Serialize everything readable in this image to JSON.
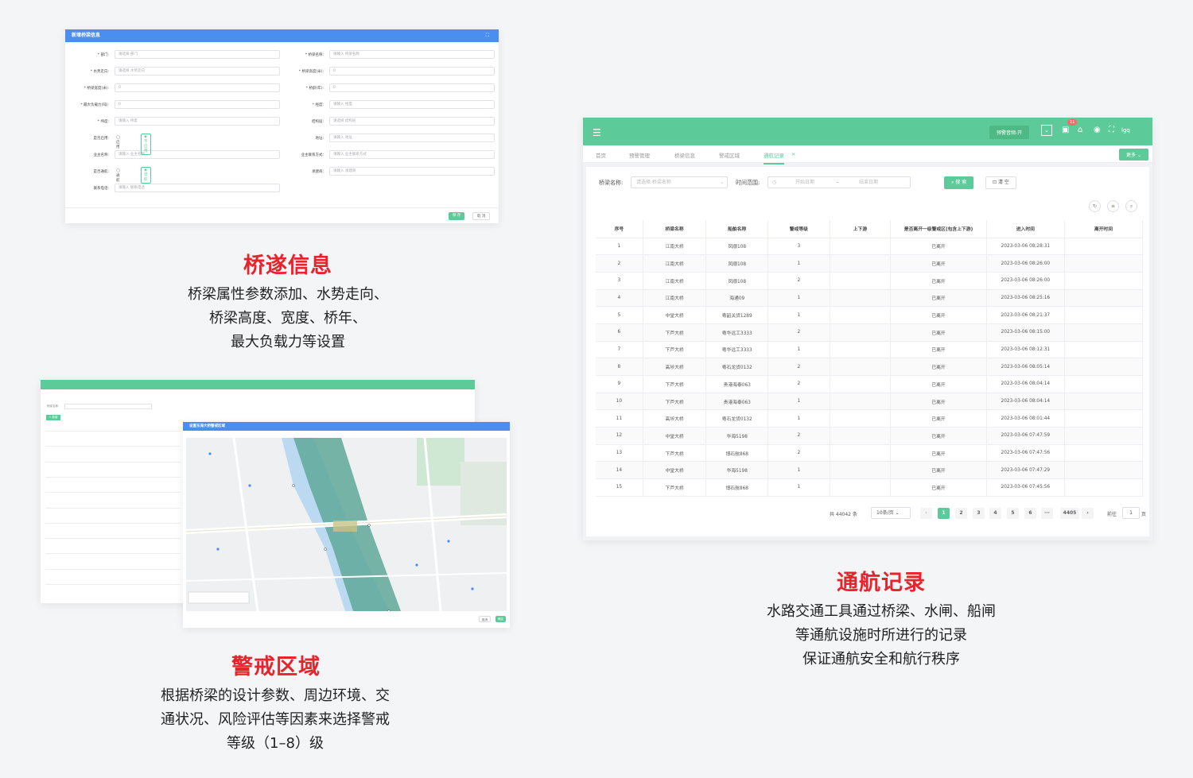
{
  "sections": {
    "bridge": {
      "title": "桥遂信息",
      "lines": [
        "桥梁属性参数添加、水势走向、",
        "桥梁高度、宽度、桥年、",
        "最大负载力等设置"
      ]
    },
    "alert": {
      "title": "警戒区域",
      "lines": [
        "根据桥梁的设计参数、周边环境、交",
        "通状况、风险评估等因素来选择警戒",
        "等级（1–8）级"
      ]
    },
    "navigation": {
      "title": "通航记录",
      "lines": [
        "水路交通工具通过桥梁、水闸、船闸",
        "等通航设施时所进行的记录",
        "保证通航安全和航行秩序"
      ]
    }
  },
  "form": {
    "header": "新增桥梁信息",
    "expand_icon": "expand-icon",
    "fields": [
      {
        "label": "* 部门:",
        "value": "请选择 部门"
      },
      {
        "label": "* 桥梁名称:",
        "value": "请输入 桥梁名称"
      },
      {
        "label": "* 水势走向:",
        "value": "请选择 水势走向"
      },
      {
        "label": "* 桥梁高度(米):",
        "value": "0"
      },
      {
        "label": "* 桥梁宽度(米):",
        "value": "0"
      },
      {
        "label": "* 桥龄(年):",
        "value": "0"
      },
      {
        "label": "* 最大负载力(吨):",
        "value": "0"
      },
      {
        "label": "* 经度:",
        "value": "请输入 经度"
      },
      {
        "label": "* 纬度:",
        "value": "请输入 纬度"
      },
      {
        "label": "结构层:",
        "value": "请选择 结构层"
      },
      {
        "label": "地址:",
        "value": "请输入 地址"
      },
      {
        "label": "业主名称:",
        "value": "请输入 业主名称"
      },
      {
        "label": "业主联系方式:",
        "value": "请输入 业主联系方式"
      },
      {
        "label": "承建商:",
        "value": "请输入 承建商"
      },
      {
        "label": "联系电话:",
        "value": "请输入 联系电话"
      }
    ],
    "radio1_label": "是否启用:",
    "radio1_a": "启用",
    "radio1_b": "不启用",
    "radio2_label": "是否通航:",
    "radio2_a": "通航",
    "radio2_b": "禁航",
    "save": "保 存",
    "cancel": "取 消"
  },
  "nav": {
    "top_button": "预警音频-开",
    "badge": "11",
    "user": "lgq",
    "tabs": [
      "首页",
      "预警管理",
      "桥梁信息",
      "警戒区域",
      "通航记录"
    ],
    "more": "更多",
    "filter_label": "桥梁名称:",
    "filter_placeholder": "请选择 桥梁名称",
    "time_label": "时间范围:",
    "start_placeholder": "开始日期",
    "dash": "-",
    "end_placeholder": "结束日期",
    "search": "搜 索",
    "clear": "清 空",
    "columns": [
      "序号",
      "桥梁名称",
      "船舶名称",
      "警戒等级",
      "上下游",
      "是否离开一级警戒区(包含上下游)",
      "进入时间",
      "离开时间"
    ],
    "rows": [
      [
        "1",
        "江南大桥",
        "凤顺108",
        "3",
        "",
        "已离开",
        "2023-03-06 08:28:31",
        ""
      ],
      [
        "2",
        "江南大桥",
        "凤顺108",
        "1",
        "",
        "已离开",
        "2023-03-06 08:26:00",
        ""
      ],
      [
        "3",
        "江南大桥",
        "凤顺108",
        "2",
        "",
        "已离开",
        "2023-03-06 08:26:00",
        ""
      ],
      [
        "4",
        "江南大桥",
        "海通09",
        "1",
        "",
        "已离开",
        "2023-03-06 08:25:16",
        ""
      ],
      [
        "5",
        "中堂大桥",
        "粤韶关货1289",
        "1",
        "",
        "已离开",
        "2023-03-06 08:21:37",
        ""
      ],
      [
        "6",
        "下芦大桥",
        "粤华远工3333",
        "2",
        "",
        "已离开",
        "2023-03-06 08:15:00",
        ""
      ],
      [
        "7",
        "下芦大桥",
        "粤华远工3333",
        "1",
        "",
        "已离开",
        "2023-03-06 08:12:31",
        ""
      ],
      [
        "8",
        "高埗大桥",
        "粤石龙货0132",
        "2",
        "",
        "已离开",
        "2023-03-06 08:05:14",
        ""
      ],
      [
        "9",
        "下芦大桥",
        "贵港海泰063",
        "2",
        "",
        "已离开",
        "2023-03-06 08:04:14",
        ""
      ],
      [
        "10",
        "下芦大桥",
        "贵港海泰063",
        "1",
        "",
        "已离开",
        "2023-03-06 08:04:14",
        ""
      ],
      [
        "11",
        "高埗大桥",
        "粤石龙货0132",
        "1",
        "",
        "已离开",
        "2023-03-06 08:01:44",
        ""
      ],
      [
        "12",
        "中堂大桥",
        "华海5198",
        "2",
        "",
        "已离开",
        "2023-03-06 07:47:59",
        ""
      ],
      [
        "13",
        "下芦大桥",
        "博石航868",
        "2",
        "",
        "已离开",
        "2023-03-06 07:47:56",
        ""
      ],
      [
        "14",
        "中堂大桥",
        "华海5198",
        "1",
        "",
        "已离开",
        "2023-03-06 07:47:29",
        ""
      ],
      [
        "15",
        "下芦大桥",
        "博石航868",
        "1",
        "",
        "已离开",
        "2023-03-06 07:45:56",
        ""
      ]
    ],
    "total": "共 44042 条",
    "page_size": "10条/页",
    "pages": [
      "1",
      "2",
      "3",
      "4",
      "5",
      "6",
      "···",
      "4405"
    ],
    "goto": "前往",
    "goto_value": "1",
    "page_unit": "页"
  },
  "zone": {
    "dialog_title": "设置东海大桥警戒区域",
    "filter_label": "桥梁名称:",
    "add": "+ 新增",
    "cancel": "取消",
    "confirm": "确定"
  }
}
